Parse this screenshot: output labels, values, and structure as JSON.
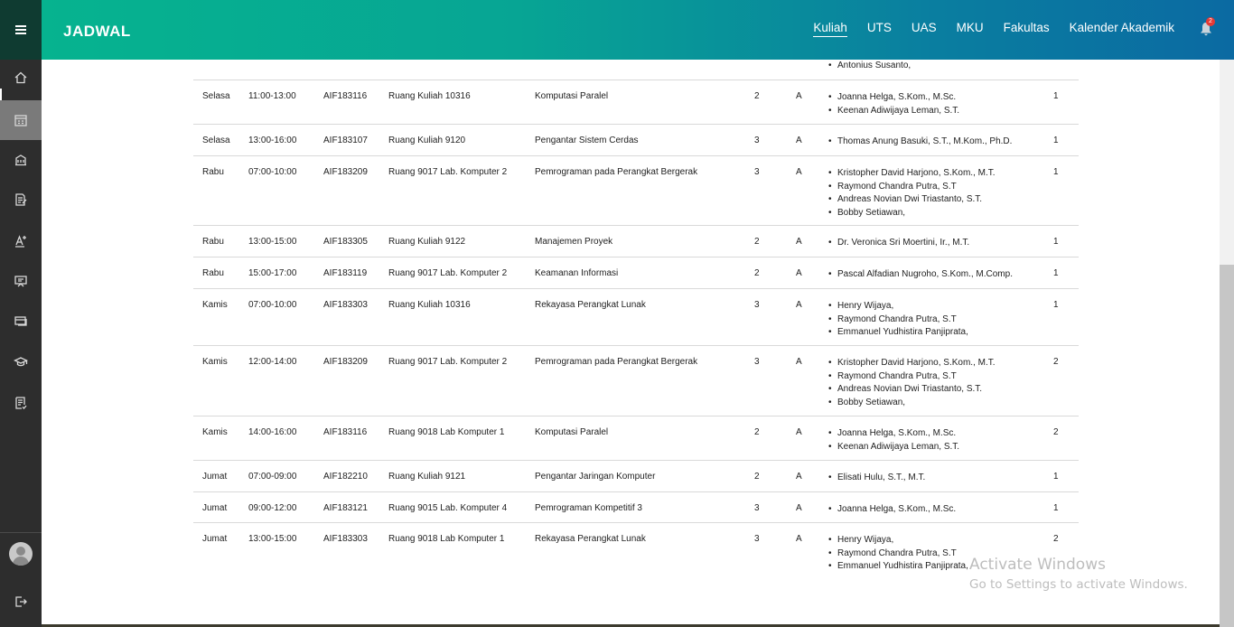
{
  "app": {
    "title": "JADWAL"
  },
  "nav": [
    {
      "label": "Kuliah",
      "active": true
    },
    {
      "label": "UTS",
      "active": false
    },
    {
      "label": "UAS",
      "active": false
    },
    {
      "label": "MKU",
      "active": false
    },
    {
      "label": "Fakultas",
      "active": false
    },
    {
      "label": "Kalender Akademik",
      "active": false
    }
  ],
  "notifications": {
    "count": "2",
    "icon": "bell-icon"
  },
  "sidebar": {
    "items": [
      {
        "icon": "home-icon"
      },
      {
        "icon": "schedule-icon",
        "active": true
      },
      {
        "icon": "building-icon"
      },
      {
        "icon": "document-edit-icon"
      },
      {
        "icon": "text-format-icon"
      },
      {
        "icon": "presentation-icon"
      },
      {
        "icon": "card-icon"
      },
      {
        "icon": "graduation-cap-icon"
      },
      {
        "icon": "list-check-icon"
      }
    ],
    "bottom": [
      {
        "icon": "avatar-icon"
      },
      {
        "icon": "logout-icon"
      }
    ]
  },
  "partial_top": {
    "lecturer": "Antonius Susanto,"
  },
  "schedule": [
    {
      "day": "Selasa",
      "time": "11:00-13:00",
      "code": "AIF183116",
      "room": "Ruang Kuliah 10316",
      "course": "Komputasi Paralel",
      "sks": "2",
      "class": "A",
      "lecturers": [
        "Joanna Helga, S.Kom., M.Sc.",
        "Keenan Adiwijaya Leman, S.T."
      ],
      "group": "1"
    },
    {
      "day": "Selasa",
      "time": "13:00-16:00",
      "code": "AIF183107",
      "room": "Ruang Kuliah 9120",
      "course": "Pengantar Sistem Cerdas",
      "sks": "3",
      "class": "A",
      "lecturers": [
        "Thomas Anung Basuki, S.T., M.Kom., Ph.D."
      ],
      "group": "1"
    },
    {
      "day": "Rabu",
      "time": "07:00-10:00",
      "code": "AIF183209",
      "room": "Ruang 9017 Lab. Komputer 2",
      "course": "Pemrograman pada Perangkat Bergerak",
      "sks": "3",
      "class": "A",
      "lecturers": [
        "Kristopher David Harjono, S.Kom., M.T.",
        "Raymond Chandra Putra, S.T",
        "Andreas Novian Dwi Triastanto, S.T.",
        "Bobby Setiawan,"
      ],
      "group": "1"
    },
    {
      "day": "Rabu",
      "time": "13:00-15:00",
      "code": "AIF183305",
      "room": "Ruang Kuliah 9122",
      "course": "Manajemen Proyek",
      "sks": "2",
      "class": "A",
      "lecturers": [
        "Dr. Veronica Sri Moertini, Ir., M.T."
      ],
      "group": "1"
    },
    {
      "day": "Rabu",
      "time": "15:00-17:00",
      "code": "AIF183119",
      "room": "Ruang 9017 Lab. Komputer 2",
      "course": "Keamanan Informasi",
      "sks": "2",
      "class": "A",
      "lecturers": [
        "Pascal Alfadian Nugroho, S.Kom., M.Comp."
      ],
      "group": "1"
    },
    {
      "day": "Kamis",
      "time": "07:00-10:00",
      "code": "AIF183303",
      "room": "Ruang Kuliah 10316",
      "course": "Rekayasa Perangkat Lunak",
      "sks": "3",
      "class": "A",
      "lecturers": [
        "Henry Wijaya,",
        "Raymond Chandra Putra, S.T",
        "Emmanuel Yudhistira Panjiprata,"
      ],
      "group": "1"
    },
    {
      "day": "Kamis",
      "time": "12:00-14:00",
      "code": "AIF183209",
      "room": "Ruang 9017 Lab. Komputer 2",
      "course": "Pemrograman pada Perangkat Bergerak",
      "sks": "3",
      "class": "A",
      "lecturers": [
        "Kristopher David Harjono, S.Kom., M.T.",
        "Raymond Chandra Putra, S.T",
        "Andreas Novian Dwi Triastanto, S.T.",
        "Bobby Setiawan,"
      ],
      "group": "2"
    },
    {
      "day": "Kamis",
      "time": "14:00-16:00",
      "code": "AIF183116",
      "room": "Ruang 9018 Lab Komputer 1",
      "course": "Komputasi Paralel",
      "sks": "2",
      "class": "A",
      "lecturers": [
        "Joanna Helga, S.Kom., M.Sc.",
        "Keenan Adiwijaya Leman, S.T."
      ],
      "group": "2"
    },
    {
      "day": "Jumat",
      "time": "07:00-09:00",
      "code": "AIF182210",
      "room": "Ruang Kuliah 9121",
      "course": "Pengantar Jaringan Komputer",
      "sks": "2",
      "class": "A",
      "lecturers": [
        "Elisati Hulu, S.T., M.T."
      ],
      "group": "1"
    },
    {
      "day": "Jumat",
      "time": "09:00-12:00",
      "code": "AIF183121",
      "room": "Ruang 9015 Lab. Komputer 4",
      "course": "Pemrograman Kompetitif 3",
      "sks": "3",
      "class": "A",
      "lecturers": [
        "Joanna Helga, S.Kom., M.Sc."
      ],
      "group": "1"
    },
    {
      "day": "Jumat",
      "time": "13:00-15:00",
      "code": "AIF183303",
      "room": "Ruang 9018 Lab Komputer 1",
      "course": "Rekayasa Perangkat Lunak",
      "sks": "3",
      "class": "A",
      "lecturers": [
        "Henry Wijaya,",
        "Raymond Chandra Putra, S.T",
        "Emmanuel Yudhistira Panjiprata,"
      ],
      "group": "2"
    }
  ],
  "watermark": {
    "line1": "Activate Windows",
    "line2": "Go to Settings to activate Windows."
  }
}
